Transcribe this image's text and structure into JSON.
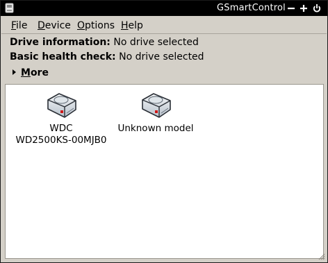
{
  "window": {
    "title": "GSmartControl"
  },
  "menubar": {
    "items": [
      {
        "first": "F",
        "rest": "ile"
      },
      {
        "first": "D",
        "rest": "evice"
      },
      {
        "first": "O",
        "rest": "ptions"
      },
      {
        "first": "H",
        "rest": "elp"
      }
    ]
  },
  "info": {
    "drive_label": "Drive information:",
    "drive_value": "No drive selected",
    "health_label": "Basic health check:",
    "health_value": "No drive selected",
    "more_first": "M",
    "more_rest": "ore"
  },
  "drives": [
    {
      "model_line1": "WDC",
      "model_line2": "WD2500KS-00MJB0",
      "icon": "hard-drive-icon"
    },
    {
      "model_line1": "Unknown model",
      "model_line2": "",
      "icon": "hard-drive-icon"
    }
  ],
  "colors": {
    "titlebar": "#000000",
    "window_bg": "#d4d0c8",
    "content_bg": "#ffffff",
    "drive_led": "#d01818"
  }
}
